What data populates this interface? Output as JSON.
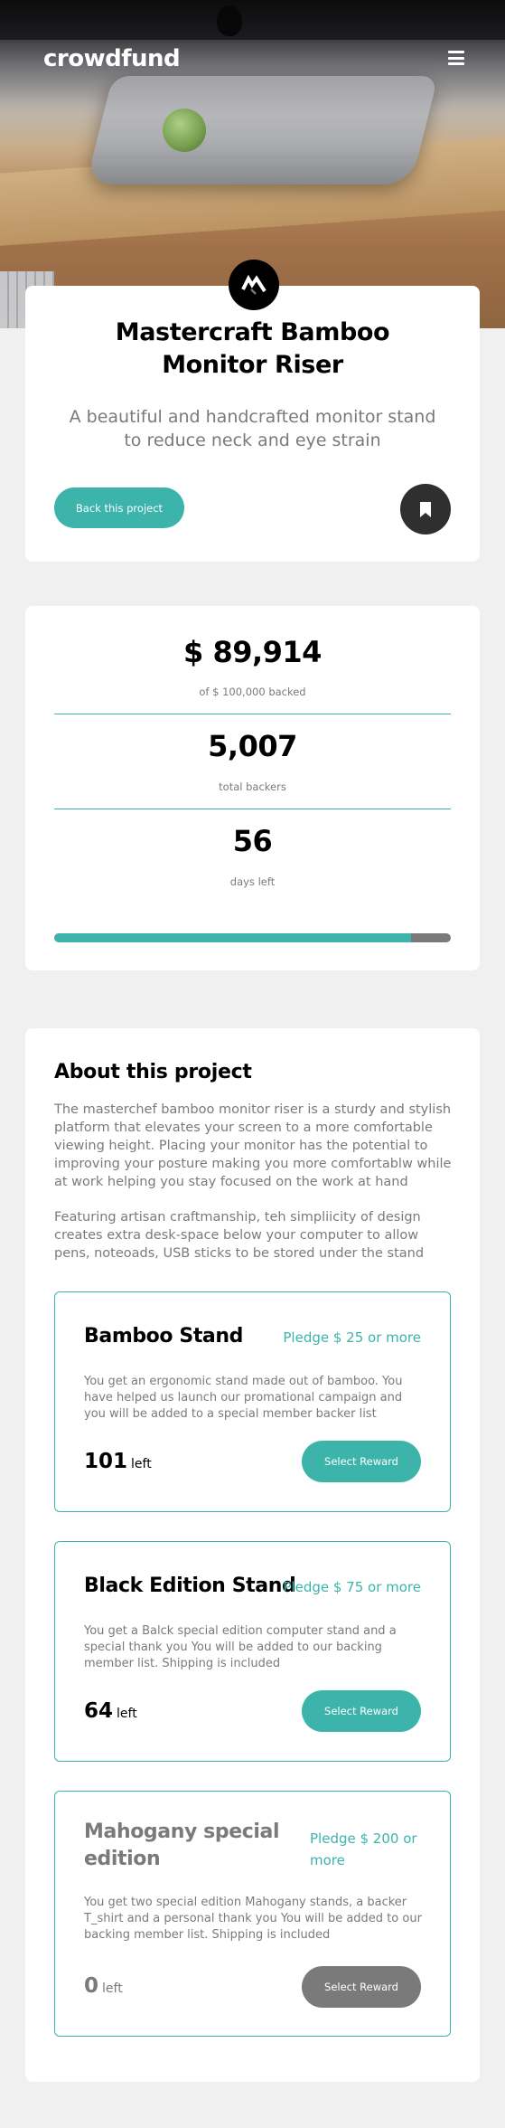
{
  "header": {
    "logo": "crowdfund",
    "menu_icon": "hamburger-menu-icon"
  },
  "hero": {
    "image": "bamboo monitor riser on desk"
  },
  "project": {
    "logo_icon": "mastercraft-logo-icon",
    "title": "Mastercraft Bamboo Monitor Riser",
    "subtitle": "A beautiful and handcrafted monitor stand to reduce neck and eye strain",
    "back_button": "Back this project",
    "bookmark_icon": "bookmark-icon"
  },
  "stats": {
    "backed_amount": "$ 89,914",
    "backed_label": "of $ 100,000 backed",
    "backers": "5,007",
    "backers_label": "total backers",
    "days": "56",
    "days_label": "days left",
    "progress_fraction": 0.899
  },
  "about": {
    "heading": "About this project",
    "paragraph1": "The masterchef bamboo monitor riser is a sturdy and stylish platform that elevates your screen to a more comfortable viewing height. Placing your monitor has the potential to improving your posture making you more comfortablw while at work helping you stay focused on the work at hand",
    "paragraph2": "Featuring artisan craftmanship, teh simpliicity of design creates extra desk-space below your computer to allow pens, noteoads, USB sticks to be stored under the stand",
    "pledges": [
      {
        "title": "Bamboo Stand",
        "amount": "Pledge $ 25 or more",
        "description": "You get an ergonomic stand made out of bamboo. You have helped us launch our promational campaign and you will be added to a special member backer list",
        "left_count": "101",
        "left_label": "left",
        "button": "Select Reward"
      },
      {
        "title": "Black Edition Stand",
        "amount": "Pledge $ 75 or more",
        "description": "You get a Balck special edition computer stand and a special thank you You will be added to our backing member list. Shipping is included",
        "left_count": "64",
        "left_label": "left",
        "button": "Select Reward"
      },
      {
        "title": "Mahogany special edition",
        "amount": "Pledge $ 200 or more",
        "description": "You get two special edition Mahogany stands, a backer T_shirt and a personal thank you You will be added to our backing member list. Shipping is included",
        "left_count": "0",
        "left_label": "left",
        "button": "Select Reward"
      }
    ]
  },
  "colors": {
    "accent": "#3cb4ac",
    "disabled": "#7a7a7a",
    "background": "#f0f0f0"
  }
}
